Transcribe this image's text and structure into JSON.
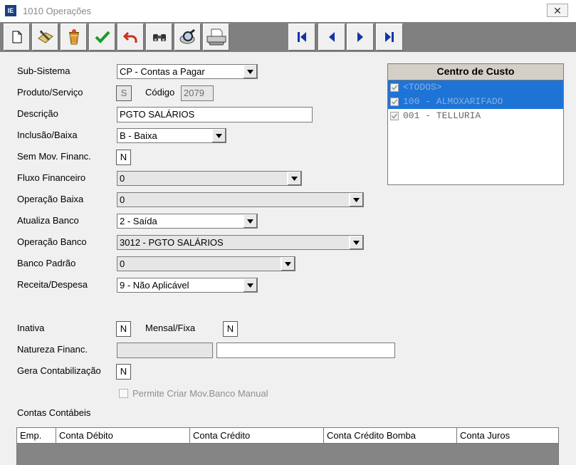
{
  "window": {
    "title": "1010 Operações",
    "close_glyph": "✕",
    "app_icon_text": "IE"
  },
  "toolbar": {
    "buttons": [
      {
        "name": "new-document-icon"
      },
      {
        "name": "edit-icon"
      },
      {
        "name": "delete-icon"
      },
      {
        "name": "confirm-check-icon"
      },
      {
        "name": "undo-icon"
      },
      {
        "name": "binoculars-search-icon"
      },
      {
        "name": "magnifier-icon"
      },
      {
        "name": "printer-icon"
      }
    ],
    "nav": [
      "first-record-icon",
      "previous-record-icon",
      "next-record-icon",
      "last-record-icon"
    ]
  },
  "form": {
    "sub_sistema": {
      "label": "Sub-Sistema",
      "value": "CP - Contas a Pagar"
    },
    "produto_servico": {
      "label": "Produto/Serviço",
      "value": "S"
    },
    "codigo": {
      "label": "Código",
      "value": "2079"
    },
    "descricao": {
      "label": "Descrição",
      "value": "PGTO SALÁRIOS"
    },
    "inclusao_baixa": {
      "label": "Inclusão/Baixa",
      "value": "B - Baixa"
    },
    "sem_mov_financ": {
      "label": "Sem Mov. Financ.",
      "value": "N"
    },
    "fluxo_financeiro": {
      "label": "Fluxo Financeiro",
      "value": "0"
    },
    "operacao_baixa": {
      "label": "Operação Baixa",
      "value": "0"
    },
    "atualiza_banco": {
      "label": "Atualiza Banco",
      "value": "2 - Saída"
    },
    "operacao_banco": {
      "label": "Operação Banco",
      "value": "3012 - PGTO SALÁRIOS"
    },
    "banco_padrao": {
      "label": "Banco Padrão",
      "value": "0"
    },
    "receita_despesa": {
      "label": "Receita/Despesa",
      "value": "9 - Não Aplicável"
    },
    "inativa": {
      "label": "Inativa",
      "value": "N"
    },
    "mensal_fixa": {
      "label": "Mensal/Fixa",
      "value": "N"
    },
    "natureza_financ": {
      "label": "Natureza Financ.",
      "code": "",
      "desc": ""
    },
    "gera_contabilizacao": {
      "label": "Gera Contabilização",
      "value": "N"
    },
    "permite_criar": {
      "label": "Permite Criar Mov.Banco Manual",
      "checked": false
    }
  },
  "centro_custo": {
    "title": "Centro de Custo",
    "items": [
      {
        "label": "<TODOS>",
        "checked": true,
        "selected": true
      },
      {
        "label": "100 - ALMOXARIFADO",
        "checked": true,
        "selected": true
      },
      {
        "label": "001 - TELLURIA",
        "checked": true,
        "selected": false
      }
    ]
  },
  "contas": {
    "label": "Contas Contábeis",
    "columns": [
      "Emp.",
      "Conta Débito",
      "Conta Crédito",
      "Conta Crédito Bomba",
      "Conta Juros"
    ]
  }
}
